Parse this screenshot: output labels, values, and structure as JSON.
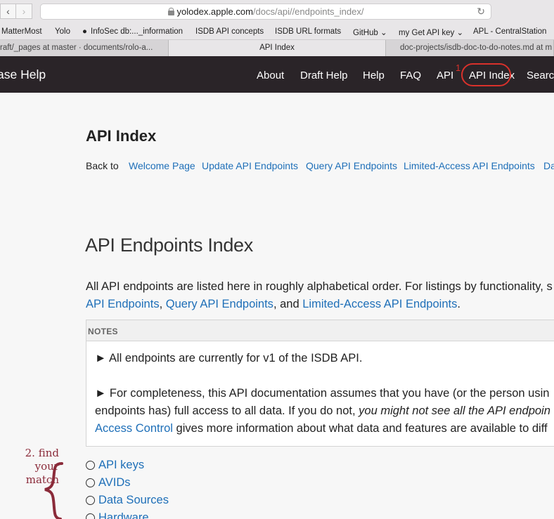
{
  "browser": {
    "url_host": "yolodex.apple.com",
    "url_path": "/docs/api//endpoints_index/",
    "bookmarks": [
      "MatterMost",
      "Yolo",
      "InfoSec db:..._information",
      "ISDB API concepts",
      "ISDB URL formats",
      "GitHub",
      "my Get API key",
      "APL - CentralStation"
    ],
    "tabs": [
      {
        "label": "raft/_pages at master · documents/rolo-a..."
      },
      {
        "label": "API Index"
      },
      {
        "label": "doc-projects/isdb-doc-to-do-notes.md at m"
      }
    ]
  },
  "site_nav": {
    "brand": "ase Help",
    "links": [
      "About",
      "Draft Help",
      "Help",
      "FAQ",
      "API",
      "API Index",
      "Search"
    ],
    "annotation_number": "1"
  },
  "page": {
    "title": "API Index",
    "back_to_label": "Back to",
    "back_links": [
      "Welcome Page",
      "Update API Endpoints",
      "Query API Endpoints",
      "Limited-Access API Endpoints",
      "Da"
    ],
    "section_title": "API Endpoints Index",
    "intro_line1": "All API endpoints are listed here in roughly alphabetical order. For listings by functionality, s",
    "intro_link1": "API Endpoints",
    "intro_sep1": ", ",
    "intro_link2": "Query API Endpoints",
    "intro_sep2": ", and ",
    "intro_link3": "Limited-Access API Endpoints",
    "intro_end": ".",
    "notes": {
      "header": "NOTES",
      "note1": "► All endpoints are currently for v1 of the ISDB API.",
      "note2_line1": "► For completeness, this API documentation assumes that you have (or the person usin",
      "note2_line2_plain": "endpoints has) full access to all data. If you do not, ",
      "note2_line2_italic": "you might not see all the API endpoin",
      "note2_line3_link": "Access Control",
      "note2_line3_rest": " gives more information about what data and features are available to diff"
    },
    "endpoints": [
      "API keys",
      "AVIDs",
      "Data Sources",
      "Hardware"
    ]
  },
  "annotation": {
    "line1": "2. find your",
    "line2": "match"
  },
  "colors": {
    "link": "#1e6fb8",
    "nav_bg": "#2a2428",
    "annotation_red": "#d9312b",
    "annotation_maroon": "#8b2b3a"
  }
}
